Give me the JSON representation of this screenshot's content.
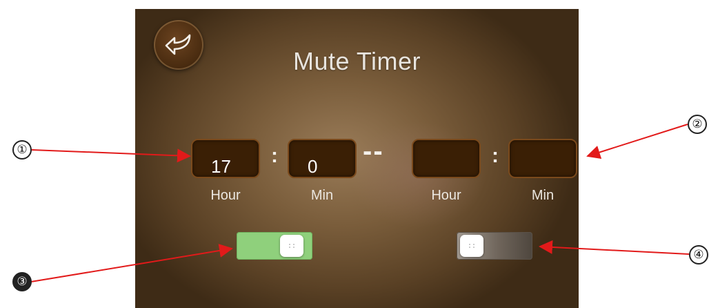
{
  "screen": {
    "title": "Mute Timer",
    "start_time": {
      "hour_value": "17",
      "min_value": "0",
      "hour_label": "Hour",
      "min_label": "Min"
    },
    "end_time": {
      "hour_value": "",
      "min_value": "",
      "hour_label": "Hour",
      "min_label": "Min"
    },
    "separator_colon": ":",
    "range_dash": "--",
    "toggles": {
      "left_state": "on",
      "right_state": "off"
    }
  },
  "annotations": {
    "marker_1": "①",
    "marker_2": "②",
    "marker_3": "③",
    "marker_4": "④"
  },
  "colors": {
    "arrow_red": "#e21a1a",
    "toggle_on": "#8fd07c",
    "time_box": "#3a1f05"
  },
  "icons": {
    "back": "back-arrow-icon"
  }
}
